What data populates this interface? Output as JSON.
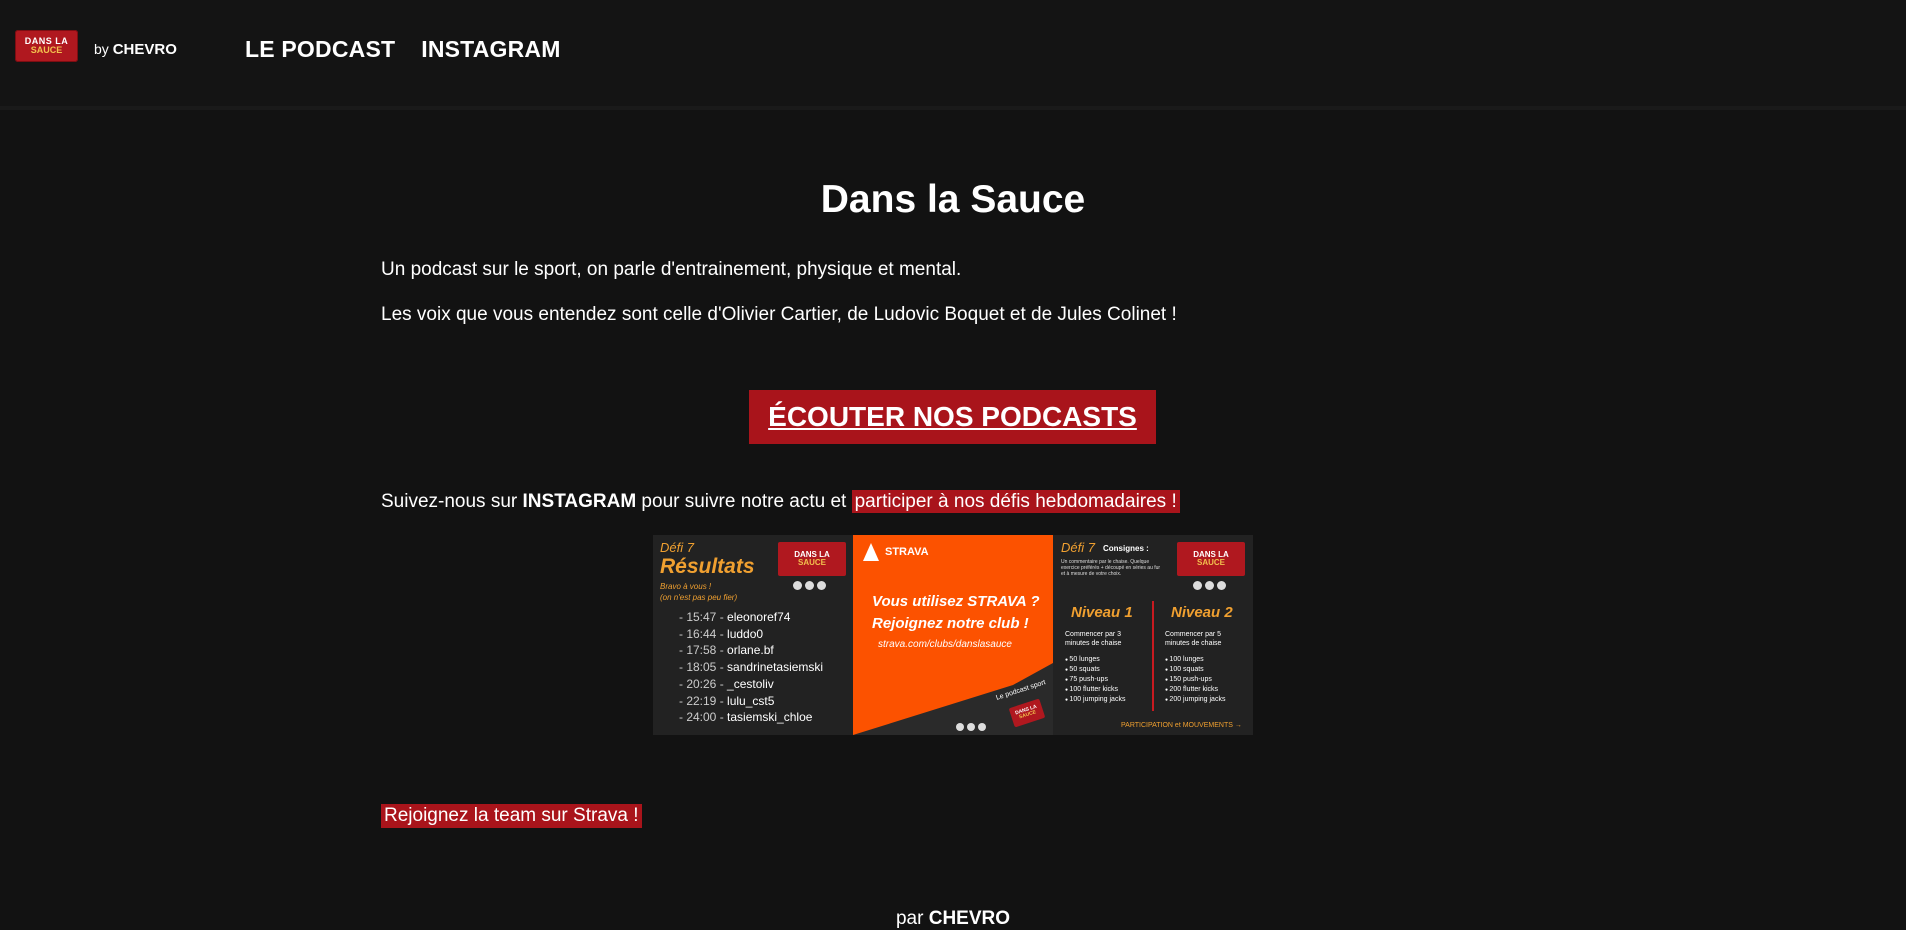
{
  "header": {
    "logo": {
      "line1": "DANS LA",
      "line2": "SAUCE"
    },
    "by_prefix": "by",
    "by_name": "CHEVRO",
    "nav": [
      {
        "label": "LE PODCAST"
      },
      {
        "label": "INSTAGRAM"
      }
    ]
  },
  "main": {
    "title": "Dans la Sauce",
    "intro_1": "Un podcast sur le sport, on parle d'entrainement, physique et mental.",
    "intro_2": "Les voix que vous entendez sont celle d'Olivier Cartier, de Ludovic Boquet et de Jules Colinet !",
    "cta_label": "ÉCOUTER NOS PODCASTS",
    "instagram_prefix": "Suivez-nous sur ",
    "instagram_bold": "INSTAGRAM",
    "instagram_middle": " pour suivre notre actu et ",
    "instagram_highlight": "participer à nos défis hebdomadaires !",
    "strava_join": "Rejoignez la team sur Strava !"
  },
  "banner": {
    "results": {
      "defi": "Défi 7",
      "title": "Résultats",
      "sub1": "Bravo à vous !",
      "sub2": "(on n'est pas peu fier)",
      "entries": [
        {
          "time": "- 15:47 -",
          "name": "eleonoref74"
        },
        {
          "time": "- 16:44 -",
          "name": "luddo0"
        },
        {
          "time": "- 17:58 -",
          "name": "orlane.bf"
        },
        {
          "time": "- 18:05 -",
          "name": "sandrinetasiemski"
        },
        {
          "time": "- 20:26 -",
          "name": "_cestoliv"
        },
        {
          "time": "- 22:19 -",
          "name": "lulu_cst5"
        },
        {
          "time": "- 24:00 -",
          "name": "tasiemski_chloe"
        }
      ]
    },
    "strava": {
      "brand": "STRAVA",
      "line1": "Vous utilisez STRAVA ?",
      "line2": "Rejoignez notre club !",
      "url": "strava.com/clubs/danslasauce",
      "tag": "Le podcast sport"
    },
    "instructions": {
      "defi": "Défi 7",
      "consignes": "Consignes :",
      "info": "Un commentaire par le chaise. Quelque exercice préférés + découpé en séries au fur et à mesure de votre choix.",
      "levels": [
        {
          "name": "Niveau 1",
          "intro": "Commencer par 3 minutes de chaise",
          "items": [
            "50 lunges",
            "50 squats",
            "75 push-ups",
            "100 flutter kicks",
            "100 jumping jacks"
          ]
        },
        {
          "name": "Niveau 2",
          "intro": "Commencer par 5 minutes de chaise",
          "items": [
            "100 lunges",
            "100 squats",
            "150 push-ups",
            "200 flutter kicks",
            "200 jumping jacks"
          ]
        }
      ],
      "footer": "PARTICIPATION et MOUVEMENTS →"
    }
  },
  "footer": {
    "prefix": "par",
    "name": "CHEVRO"
  },
  "colors": {
    "background": "#121212",
    "accent_red": "#a9141b",
    "strava_orange": "#fc5200",
    "label_orange": "#f0a030"
  }
}
